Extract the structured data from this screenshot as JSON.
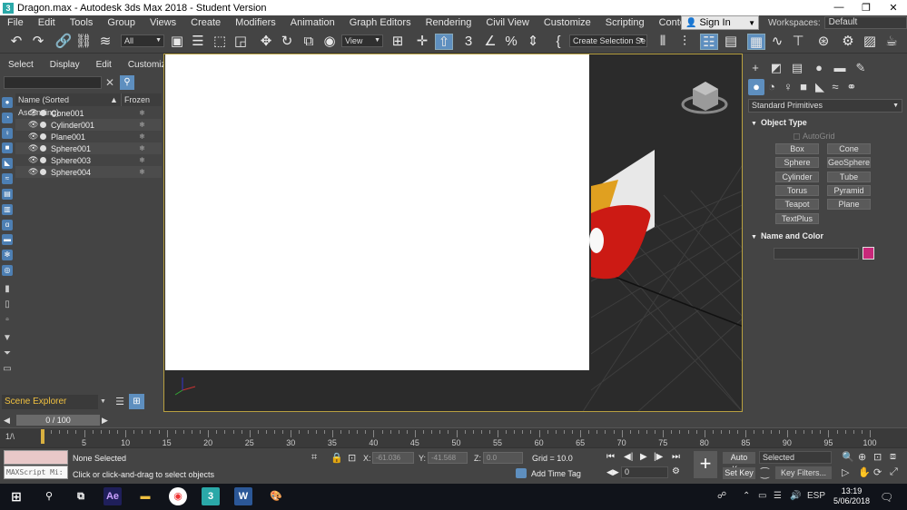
{
  "window": {
    "title": "Dragon.max - Autodesk 3ds Max 2018 - Student Version",
    "app_icon": "3",
    "controls": [
      "—",
      "❐",
      "✕"
    ]
  },
  "menu": [
    "File",
    "Edit",
    "Tools",
    "Group",
    "Views",
    "Create",
    "Modifiers",
    "Animation",
    "Graph Editors",
    "Rendering",
    "Civil View",
    "Customize",
    "Scripting",
    "Content"
  ],
  "signin": {
    "label": "Sign In"
  },
  "workspaces": {
    "label": "Workspaces:",
    "value": "Default"
  },
  "toolbar": {
    "selection_filter": "All",
    "ref_coord": "View",
    "named_selection": "Create Selection Se"
  },
  "scene_explorer": {
    "tabs": [
      "Select",
      "Display",
      "Edit",
      "Customize"
    ],
    "search_placeholder": "",
    "col_name": "Name (Sorted Ascending)",
    "col_sort": "▲",
    "col_frozen": "Frozen",
    "objects": [
      "Cone001",
      "Cylinder001",
      "Plane001",
      "Sphere001",
      "Sphere003",
      "Sphere004"
    ],
    "footer_label": "Scene Explorer"
  },
  "command_panel": {
    "category": "Standard Primitives",
    "object_type_title": "Object Type",
    "autogrid": "AutoGrid",
    "buttons": [
      "Box",
      "Cone",
      "Sphere",
      "GeoSphere",
      "Cylinder",
      "Tube",
      "Torus",
      "Pyramid",
      "Teapot",
      "Plane",
      "TextPlus"
    ],
    "name_color_title": "Name and Color",
    "object_color": "#c8287a"
  },
  "timeline": {
    "frame_display": "0 / 100",
    "ticks": [
      5,
      10,
      15,
      20,
      25,
      30,
      35,
      40,
      45,
      50,
      55,
      60,
      65,
      70,
      75,
      80,
      85,
      90,
      95,
      100
    ]
  },
  "status": {
    "maxscript": "MAXScript Mi:",
    "selection": "None Selected",
    "prompt": "Click or click-and-drag to select objects",
    "x_label": "X:",
    "x_value": "-61.036",
    "y_label": "Y:",
    "y_value": "-41.568",
    "z_label": "Z:",
    "z_value": "0.0",
    "grid": "Grid = 10.0",
    "add_time_tag": "Add Time Tag",
    "frame_spinner": "0",
    "auto_key": "Auto Key",
    "set_key": "Set Key",
    "key_mode": "Selected",
    "key_filters": "Key Filters..."
  },
  "taskbar": {
    "time": "13:19",
    "date": "5/06/2018",
    "lang": "ESP"
  }
}
